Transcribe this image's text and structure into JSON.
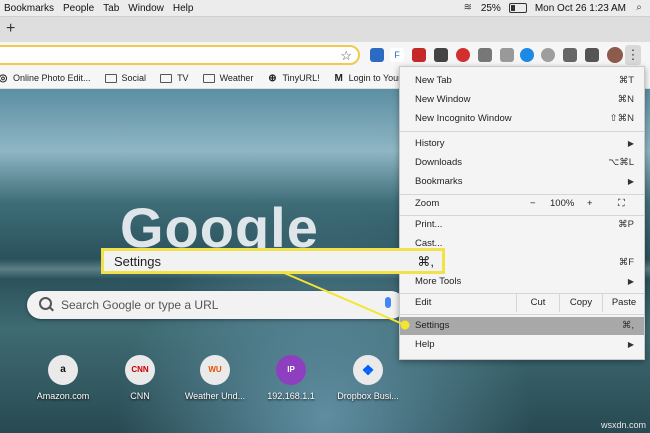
{
  "menubar": {
    "items": [
      "Bookmarks",
      "People",
      "Tab",
      "Window",
      "Help"
    ],
    "battery": "25%",
    "clock": "Mon Oct 26  1:23 AM"
  },
  "tabstrip": {
    "new_tab_symbol": "+"
  },
  "toolbar": {
    "star_symbol": "☆",
    "menu_symbol": "⋮"
  },
  "bookmarks": [
    {
      "label": "Online Photo Edit...",
      "icon": "globe-icon"
    },
    {
      "label": "Social",
      "icon": "folder-icon"
    },
    {
      "label": "TV",
      "icon": "folder-icon"
    },
    {
      "label": "Weather",
      "icon": "folder-icon"
    },
    {
      "label": "TinyURL!",
      "icon": "tinyurl-icon"
    },
    {
      "label": "Login to Your Acc...",
      "icon": "m-icon"
    }
  ],
  "page": {
    "logo": "Google",
    "search_placeholder": "Search Google or type a URL",
    "shortcuts": [
      {
        "label": "Amazon.com",
        "glyph": "a"
      },
      {
        "label": "CNN",
        "glyph": "CNN"
      },
      {
        "label": "Weather Und...",
        "glyph": "WU"
      },
      {
        "label": "192.168.1.1",
        "glyph": "IP"
      },
      {
        "label": "Dropbox Busi...",
        "glyph": "❖"
      }
    ]
  },
  "menu": {
    "new_tab": {
      "label": "New Tab",
      "key": "⌘T"
    },
    "new_window": {
      "label": "New Window",
      "key": "⌘N"
    },
    "new_incognito": {
      "label": "New Incognito Window",
      "key": "⇧⌘N"
    },
    "history": {
      "label": "History"
    },
    "downloads": {
      "label": "Downloads",
      "key": "⌥⌘L"
    },
    "bookmarks": {
      "label": "Bookmarks"
    },
    "zoom": {
      "label": "Zoom",
      "minus": "−",
      "value": "100%",
      "plus": "+",
      "fullscreen": "⛶"
    },
    "print": {
      "label": "Print...",
      "key": "⌘P"
    },
    "cast": {
      "label": "Cast..."
    },
    "find": {
      "key": "⌘F"
    },
    "more_tools": {
      "label": "More Tools"
    },
    "edit": {
      "label": "Edit",
      "cut": "Cut",
      "copy": "Copy",
      "paste": "Paste"
    },
    "settings": {
      "label": "Settings",
      "key": "⌘,"
    },
    "help": {
      "label": "Help"
    },
    "arrow": "▶"
  },
  "callout": {
    "label": "Settings",
    "key": "⌘,"
  },
  "colors": {
    "callout_border": "#f2e24a",
    "pointer": "#f5e52f",
    "highlight": "#a8a8a8"
  },
  "watermark": "wsxdn.com"
}
